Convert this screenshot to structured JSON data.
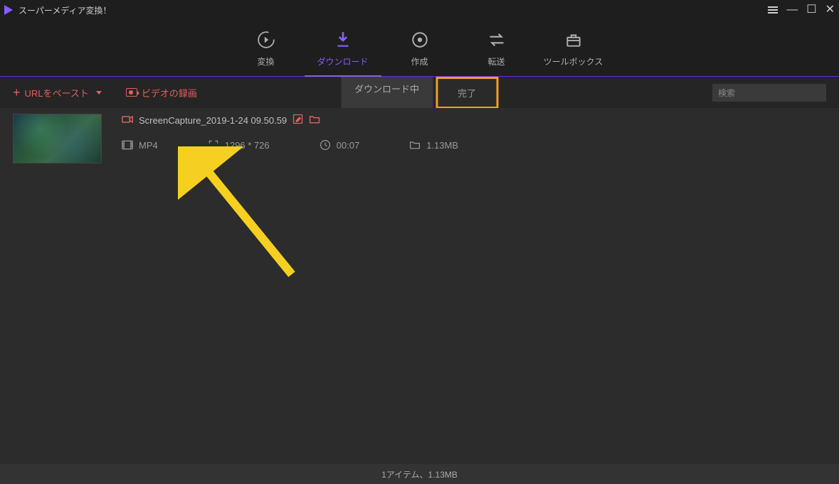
{
  "app": {
    "title": "スーパーメディア変換！"
  },
  "nav": {
    "convert": "変換",
    "download": "ダウンロード",
    "create": "作成",
    "transfer": "転送",
    "toolbox": "ツールボックス"
  },
  "toolbar": {
    "paste_url": "URLをペースト",
    "record": "ビデオの録画",
    "tab_downloading": "ダウンロード中",
    "tab_complete": "完了"
  },
  "search": {
    "placeholder": "検索"
  },
  "file": {
    "name": "ScreenCapture_2019-1-24 09.50.59",
    "format": "MP4",
    "resolution": "1296 * 726",
    "duration": "00:07",
    "size": "1.13MB"
  },
  "status": {
    "text": "1アイテム、1.13MB"
  },
  "colors": {
    "accent": "#8b5cf6",
    "danger": "#e06060",
    "highlight": "#f0a020"
  }
}
